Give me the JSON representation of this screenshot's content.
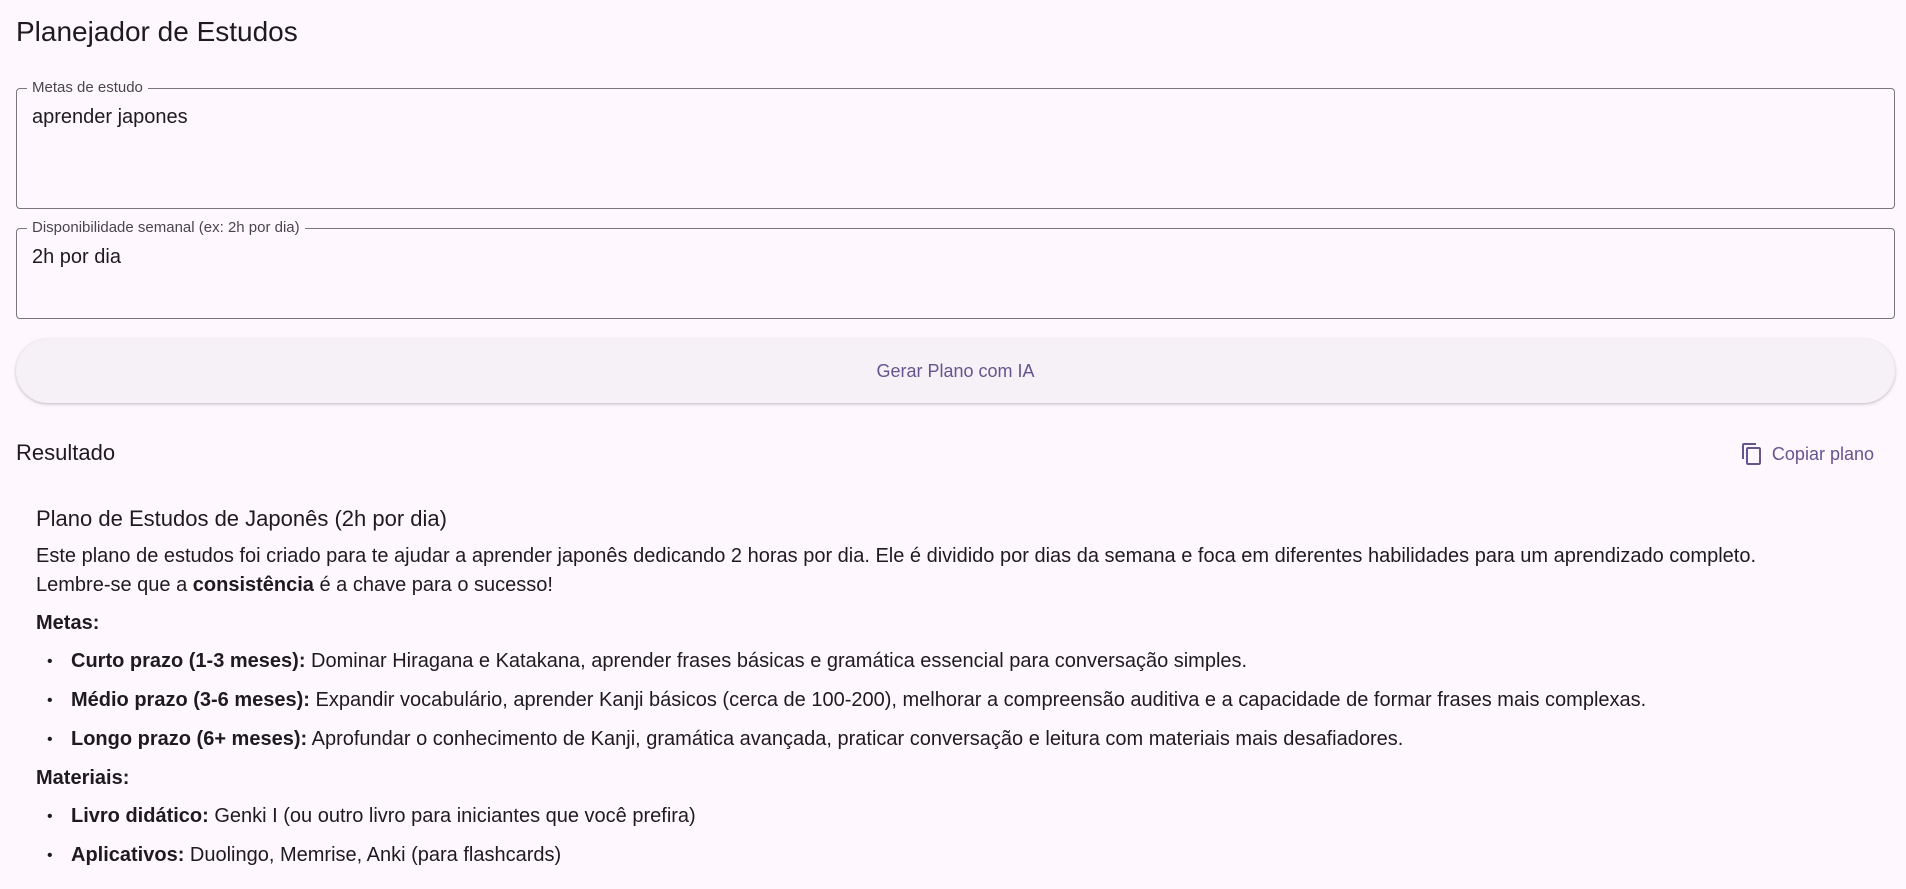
{
  "app": {
    "title": "Planejador de Estudos"
  },
  "form": {
    "goals_label": "Metas de estudo",
    "goals_value": "aprender japones",
    "availability_label": "Disponibilidade semanal (ex: 2h por dia)",
    "availability_value": "2h por dia",
    "generate_button": "Gerar Plano com IA"
  },
  "result": {
    "heading": "Resultado",
    "copy_button": "Copiar plano",
    "copy_icon": "copy-icon",
    "plan": {
      "title": "Plano de Estudos de Japonês (2h por dia)",
      "intro_line1": "Este plano de estudos foi criado para te ajudar a aprender japonês dedicando 2 horas por dia. Ele é dividido por dias da semana e foca em diferentes habilidades para um aprendizado completo.",
      "intro_line2_prefix": "Lembre-se que a ",
      "intro_line2_bold": "consistência",
      "intro_line2_suffix": " é a chave para o sucesso!",
      "goals_heading": "Metas:",
      "goals": [
        {
          "label": "Curto prazo (1-3 meses):",
          "text": " Dominar Hiragana e Katakana, aprender frases básicas e gramática essencial para conversação simples."
        },
        {
          "label": "Médio prazo (3-6 meses):",
          "text": " Expandir vocabulário, aprender Kanji básicos (cerca de 100-200), melhorar a compreensão auditiva e a capacidade de formar frases mais complexas."
        },
        {
          "label": "Longo prazo (6+ meses):",
          "text": " Aprofundar o conhecimento de Kanji, gramática avançada, praticar conversação e leitura com materiais mais desafiadores."
        }
      ],
      "materials_heading": "Materiais:",
      "materials": [
        {
          "label": "Livro didático:",
          "text": " Genki I (ou outro livro para iniciantes que você prefira)"
        },
        {
          "label": "Aplicativos:",
          "text": " Duolingo, Memrise, Anki (para flashcards)"
        }
      ]
    }
  },
  "colors": {
    "background": "#fef7fe",
    "accent": "#65558f",
    "outline": "#79747e"
  }
}
